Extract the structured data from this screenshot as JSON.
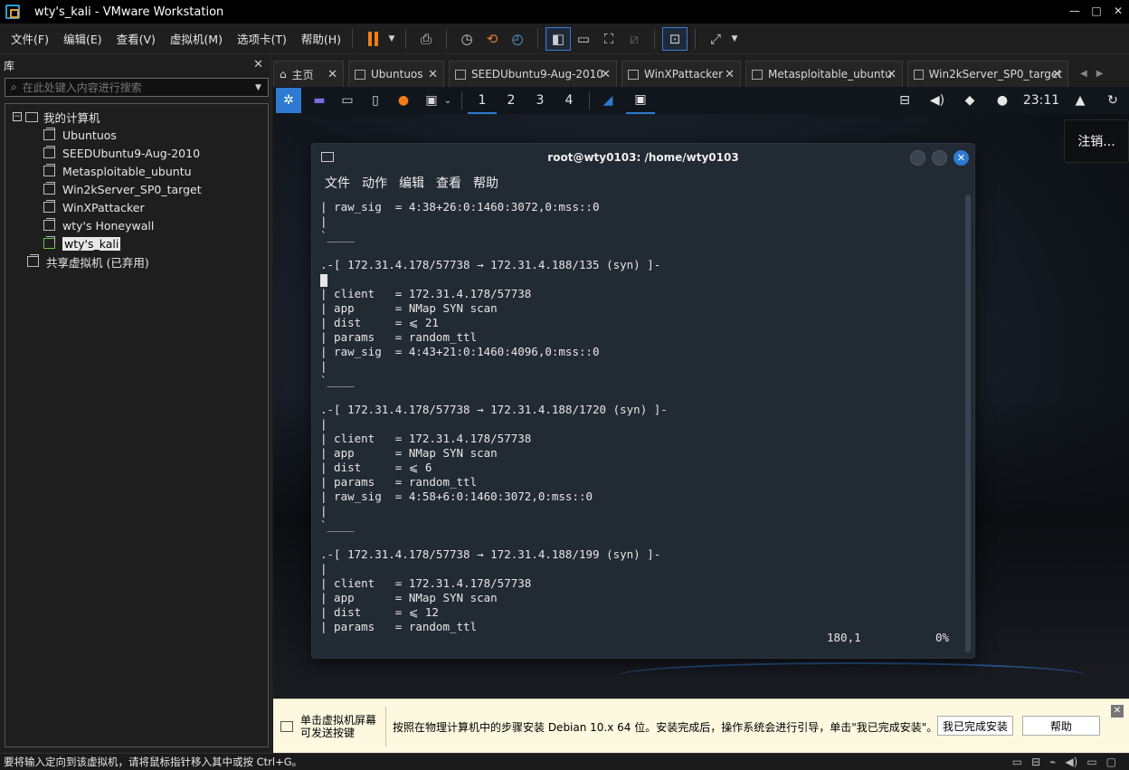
{
  "window": {
    "title": "wty's_kali - VMware Workstation",
    "min": "—",
    "max": "□",
    "close": "✕"
  },
  "menu": [
    {
      "label": "文件(F)"
    },
    {
      "label": "编辑(E)"
    },
    {
      "label": "查看(V)"
    },
    {
      "label": "虚拟机(M)"
    },
    {
      "label": "选项卡(T)"
    },
    {
      "label": "帮助(H)"
    }
  ],
  "library": {
    "title": "库",
    "close": "✕",
    "search_placeholder": "在此处键入内容进行搜索",
    "root": "我的计算机",
    "vms": [
      "Ubuntuos",
      "SEEDUbuntu9-Aug-2010",
      "Metasploitable_ubuntu",
      "Win2kServer_SP0_target",
      "WinXPattacker",
      "wty's Honeywall",
      "wty's_kali"
    ],
    "shared": "共享虚拟机 (已弃用)"
  },
  "tabs": [
    {
      "label": "主页"
    },
    {
      "label": "Ubuntuos"
    },
    {
      "label": "SEEDUbuntu9-Aug-2010"
    },
    {
      "label": "WinXPattacker"
    },
    {
      "label": "Metasploitable_ubuntu"
    },
    {
      "label": "Win2kServer_SP0_target"
    }
  ],
  "kali_panel": {
    "workspaces": [
      "1",
      "2",
      "3",
      "4"
    ],
    "clock": "23:11"
  },
  "logout_tooltip": "注销...",
  "terminal": {
    "title": "root@wty0103: /home/wty0103",
    "menu": [
      "文件",
      "动作",
      "编辑",
      "查看",
      "帮助"
    ],
    "lines": [
      "| raw_sig  = 4:38+26:0:1460:3072,0:mss::0",
      "|",
      "`____",
      "",
      ".-[ 172.31.4.178/57738 → 172.31.4.188/135 (syn) ]-",
      "",
      "| client   = 172.31.4.178/57738",
      "| app      = NMap SYN scan",
      "| dist     = ⩽ 21",
      "| params   = random_ttl",
      "| raw_sig  = 4:43+21:0:1460:4096,0:mss::0",
      "|",
      "`____",
      "",
      ".-[ 172.31.4.178/57738 → 172.31.4.188/1720 (syn) ]-",
      "|",
      "| client   = 172.31.4.178/57738",
      "| app      = NMap SYN scan",
      "| dist     = ⩽ 6",
      "| params   = random_ttl",
      "| raw_sig  = 4:58+6:0:1460:3072,0:mss::0",
      "|",
      "`____",
      "",
      ".-[ 172.31.4.178/57738 → 172.31.4.188/199 (syn) ]-",
      "|",
      "| client   = 172.31.4.178/57738",
      "| app      = NMap SYN scan",
      "| dist     = ⩽ 12",
      "| params   = random_ttl"
    ],
    "status_position": "180,1",
    "status_percent": "0%"
  },
  "hint": {
    "left_line1": "单击虚拟机屏幕",
    "left_line2": "可发送按键",
    "message": "按照在物理计算机中的步骤安装 Debian 10.x 64 位。安装完成后，操作系统会进行引导，单击\"我已完成安装\"。",
    "done_button": "我已完成安装",
    "help_button": "帮助"
  },
  "statusbar": {
    "text": "要将输入定向到该虚拟机，请将鼠标指针移入其中或按 Ctrl+G。"
  },
  "colors": {
    "kali_blue": "#2e7ad1",
    "pause_orange": "#f07d1a"
  }
}
